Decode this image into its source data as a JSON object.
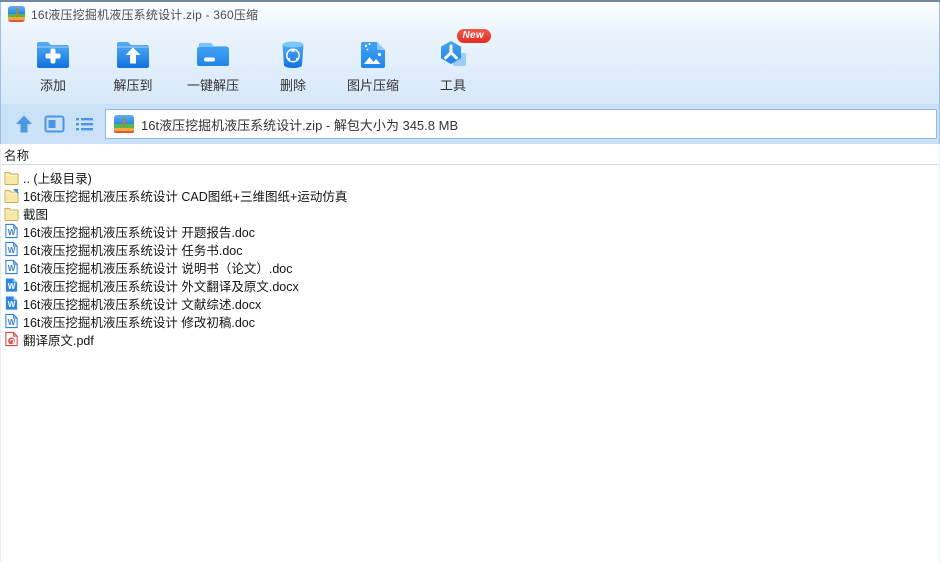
{
  "window": {
    "title": "16t液压挖掘机液压系统设计.zip - 360压缩",
    "app_name": "360压缩"
  },
  "toolbar": {
    "buttons": [
      {
        "label": "添加",
        "icon": "add-folder-icon"
      },
      {
        "label": "解压到",
        "icon": "extract-to-icon"
      },
      {
        "label": "一键解压",
        "icon": "one-key-extract-icon"
      },
      {
        "label": "删除",
        "icon": "delete-trash-icon"
      },
      {
        "label": "图片压缩",
        "icon": "image-compress-icon"
      },
      {
        "label": "工具",
        "icon": "tools-cube-icon",
        "badge": "New"
      }
    ]
  },
  "navbar": {
    "up_icon": "up-arrow-icon",
    "view_icon": "panel-view-icon",
    "list_icon": "list-view-icon",
    "address": "16t液压挖掘机液压系统设计.zip - 解包大小为 345.8 MB"
  },
  "list": {
    "header": "名称",
    "rows": [
      {
        "icon": "folder",
        "name": ".. (上级目录)"
      },
      {
        "icon": "folder-link",
        "name": "16t液压挖掘机液压系统设计 CAD图纸+三维图纸+运动仿真"
      },
      {
        "icon": "folder",
        "name": "截图"
      },
      {
        "icon": "doc",
        "name": "16t液压挖掘机液压系统设计 开题报告.doc"
      },
      {
        "icon": "doc",
        "name": "16t液压挖掘机液压系统设计 任务书.doc"
      },
      {
        "icon": "doc",
        "name": "16t液压挖掘机液压系统设计 说明书（论文）.doc"
      },
      {
        "icon": "docx",
        "name": "16t液压挖掘机液压系统设计 外文翻译及原文.docx"
      },
      {
        "icon": "docx",
        "name": "16t液压挖掘机液压系统设计 文献综述.docx"
      },
      {
        "icon": "doc",
        "name": "16t液压挖掘机液压系统设计 修改初稿.doc"
      },
      {
        "icon": "pdf",
        "name": "翻译原文.pdf"
      }
    ]
  },
  "colors": {
    "accent_blue": "#2a8ae8",
    "toolbar_bg_top": "#edf5fd",
    "toolbar_bg_bottom": "#d6e8fa",
    "navbar_bg": "#cbe1f7",
    "badge_red": "#e22c20",
    "folder_yellow": "#f7e9a8",
    "word_blue": "#2f7fd6",
    "pdf_red": "#d8453c"
  }
}
